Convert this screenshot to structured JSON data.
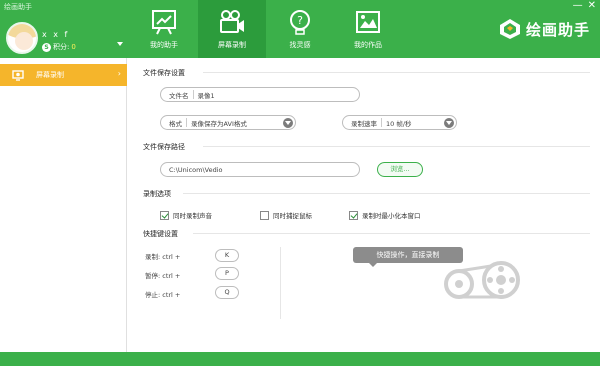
{
  "window": {
    "title": "绘画助手",
    "minimize": "—",
    "close": "✕"
  },
  "user": {
    "name": "x x f",
    "badge": "S",
    "points_label": "积分:",
    "points_value": "0"
  },
  "nav": [
    {
      "label": "我的助手"
    },
    {
      "label": "屏幕录制"
    },
    {
      "label": "找灵感"
    },
    {
      "label": "我的作品"
    }
  ],
  "brand": {
    "name": "绘画助手"
  },
  "sidebar": {
    "items": [
      {
        "label": "屏幕录制",
        "arrow": "›"
      }
    ]
  },
  "sections": {
    "file_settings": "文件保存设置",
    "file_path": "文件保存路径",
    "record_options": "录制选项",
    "hotkeys": "快捷键设置"
  },
  "fields": {
    "filename_label": "文件名",
    "filename_value": "录像1",
    "format_label": "格式",
    "format_value": "录像保存为AVI格式",
    "rate_label": "录制速率",
    "rate_value": "10 帧/秒",
    "path_value": "C:\\Unicom\\Vedio",
    "browse_label": "浏览..."
  },
  "options": [
    {
      "label": "同时录制声音",
      "checked": true
    },
    {
      "label": "同时捕捉鼠标",
      "checked": false
    },
    {
      "label": "录制时最小化本窗口",
      "checked": true
    }
  ],
  "hotkeys": [
    {
      "label": "录制: ctrl +",
      "key": "K"
    },
    {
      "label": "暂停: ctrl +",
      "key": "P"
    },
    {
      "label": "停止: ctrl +",
      "key": "Q"
    }
  ],
  "tip": "快捷操作，直接录制",
  "colors": {
    "brand_green": "#3bb04a",
    "active_tab": "#2c9c3c",
    "sidebar_active": "#f5b52b"
  },
  "icons": [
    "easel-icon",
    "video-camera-icon",
    "lightbulb-icon",
    "picture-frame-icon",
    "brand-logo-icon",
    "screen-record-icon",
    "film-reel-icon"
  ]
}
